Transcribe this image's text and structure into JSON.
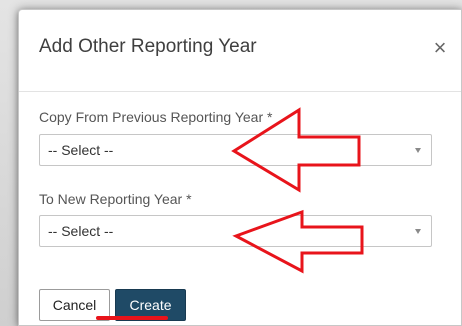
{
  "modal": {
    "title": "Add Other Reporting Year",
    "close_glyph": "×"
  },
  "fields": [
    {
      "label": "Copy From Previous Reporting Year *",
      "selected": "-- Select --"
    },
    {
      "label": "To New Reporting Year *",
      "selected": "-- Select --"
    }
  ],
  "buttons": {
    "cancel_label": "Cancel",
    "create_label": "Create"
  },
  "annotations": {
    "arrow_color": "#e8141b",
    "underline_color": "#e8141b"
  },
  "colors": {
    "primary": "#1f4a66"
  }
}
